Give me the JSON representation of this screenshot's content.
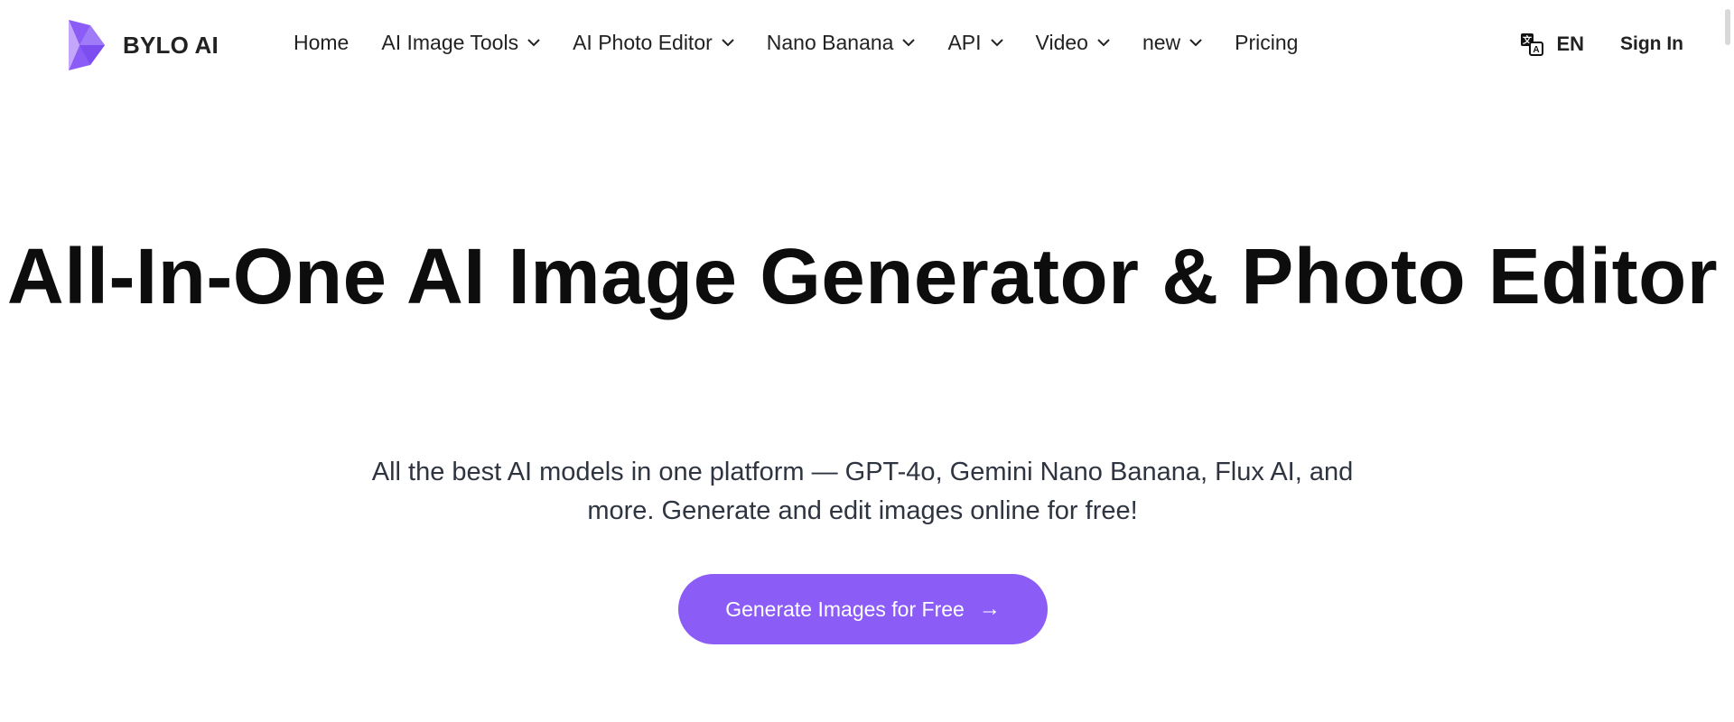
{
  "brand": {
    "name": "BYLO AI",
    "accent": "#8b5cf6"
  },
  "nav": {
    "items": [
      {
        "label": "Home",
        "dropdown": false
      },
      {
        "label": "AI Image Tools",
        "dropdown": true
      },
      {
        "label": "AI Photo Editor",
        "dropdown": true
      },
      {
        "label": "Nano Banana",
        "dropdown": true
      },
      {
        "label": "API",
        "dropdown": true
      },
      {
        "label": "Video",
        "dropdown": true
      },
      {
        "label": "new",
        "dropdown": true
      },
      {
        "label": "Pricing",
        "dropdown": false
      }
    ]
  },
  "header_right": {
    "language_icon": "translate-icon",
    "language": "EN",
    "sign_in": "Sign In"
  },
  "hero": {
    "title": "All-In-One AI Image Generator & Photo Editor",
    "subtitle": "All the best AI models in one platform — GPT-4o, Gemini Nano Banana, Flux AI, and more. Generate and edit images online for free!",
    "cta_label": "Generate Images for Free",
    "cta_icon": "arrow-right-icon",
    "cta_color": "#8b5cf6"
  }
}
